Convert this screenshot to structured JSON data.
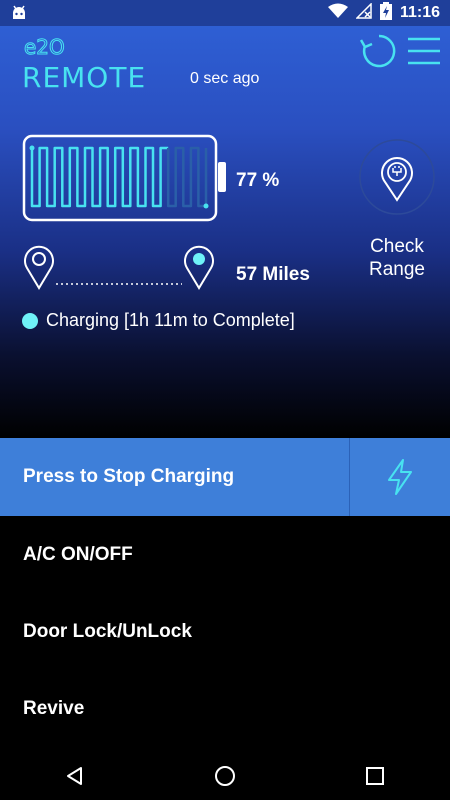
{
  "status_bar": {
    "time": "11:16",
    "icons": [
      "android-icon",
      "wifi-icon",
      "no-signal-icon",
      "battery-charging-icon"
    ]
  },
  "header": {
    "logo_text": "REMOTE",
    "logo_prefix": "e2O",
    "last_updated": "0 sec ago",
    "refresh_icon": "refresh-icon",
    "menu_icon": "hamburger-menu-icon"
  },
  "battery": {
    "percent_label": "77 %",
    "charge_level": 0.77
  },
  "range": {
    "miles_label": "57 Miles"
  },
  "check_range": {
    "label": "Check\nRange",
    "icon": "charging-location-pin-icon"
  },
  "charging_status": {
    "text": "Charging [1h 11m to Complete]"
  },
  "stop_charging": {
    "label": "Press to Stop Charging",
    "icon": "lightning-bolt-icon"
  },
  "menu": [
    {
      "label": "A/C ON/OFF"
    },
    {
      "label": "Door Lock/UnLock"
    },
    {
      "label": "Revive"
    }
  ],
  "colors": {
    "accent_cyan": "#48e2f0",
    "stop_bar": "#3e7fd9",
    "status_bar": "#1f3f9a"
  }
}
